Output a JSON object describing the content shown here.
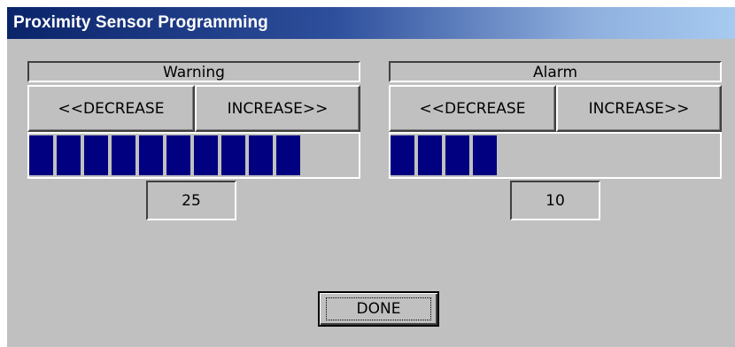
{
  "window": {
    "title": "Proximity Sensor Programming"
  },
  "colors": {
    "bar_fill": "#000080",
    "window_bg": "#c0c0c0",
    "title_gradient_start": "#0a246a",
    "title_gradient_end": "#a6caf0"
  },
  "warning": {
    "label": "Warning",
    "decrease_label": "<<DECREASE",
    "increase_label": "INCREASE>>",
    "value": "25",
    "filled_segments": 10
  },
  "alarm": {
    "label": "Alarm",
    "decrease_label": "<<DECREASE",
    "increase_label": "INCREASE>>",
    "value": "10",
    "filled_segments": 4
  },
  "done_label": "DONE"
}
